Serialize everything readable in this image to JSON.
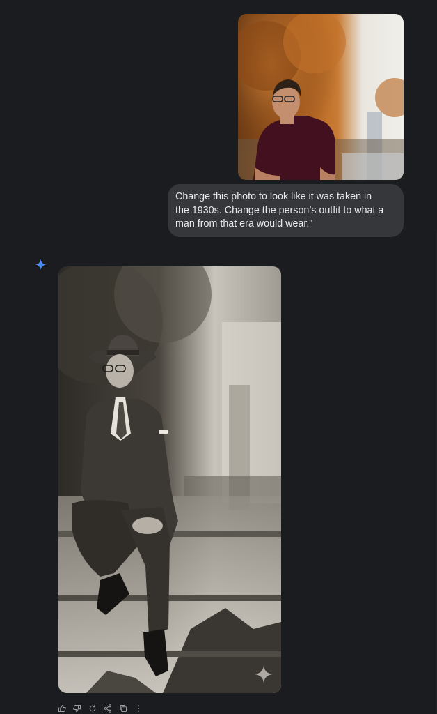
{
  "conversation": {
    "user_message": {
      "text": "Change this photo to look like it was taken in\nthe 1930s. Change the person’s outfit to what a\nman from that era would wear.”"
    },
    "assistant_message": {
      "icons": [
        "sparkle-icon"
      ]
    }
  },
  "action_bar": {
    "actions": [
      "thumbs-up-icon",
      "thumbs-down-icon",
      "regenerate-icon",
      "share-icon",
      "copy-icon",
      "more-icon"
    ]
  },
  "colors": {
    "background": "#1b1c1f",
    "bubble": "#35373a",
    "text": "#e8eaed",
    "accent": "#4c8df6",
    "icon": "#9aa0a6"
  }
}
